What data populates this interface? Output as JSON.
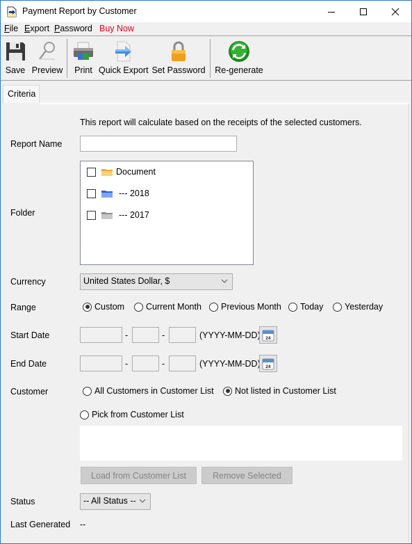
{
  "window": {
    "title": "Payment Report by Customer",
    "controls": {
      "minimize": "minimize",
      "maximize": "maximize",
      "close": "close"
    }
  },
  "menu": {
    "items": [
      {
        "label": "File",
        "accel": "F"
      },
      {
        "label": "Export",
        "accel": "E"
      },
      {
        "label": "Password",
        "accel": "P"
      },
      {
        "label": "Buy Now",
        "accel": "o"
      }
    ],
    "buy_now_color": "#e0001b"
  },
  "toolbar": {
    "buttons": [
      {
        "label": "Save",
        "icon": "floppy-disk-icon"
      },
      {
        "label": "Preview",
        "icon": "magnifier-icon"
      },
      {
        "label": "Print",
        "icon": "printer-icon"
      },
      {
        "label": "Quick Export",
        "icon": "export-arrow-icon"
      },
      {
        "label": "Set Password",
        "icon": "padlock-icon"
      },
      {
        "label": "Re-generate",
        "icon": "refresh-icon"
      }
    ]
  },
  "tabs": [
    {
      "label": "Criteria",
      "active": true
    }
  ],
  "form": {
    "intro": "This report will calculate based on the receipts of the selected customers.",
    "report_name": {
      "label": "Report Name",
      "value": ""
    },
    "folder": {
      "label": "Folder",
      "items": [
        {
          "label": "Document",
          "checked": false,
          "icon": "folder-yellow-icon"
        },
        {
          "label": "--- 2018",
          "checked": false,
          "icon": "folder-blue-icon"
        },
        {
          "label": "--- 2017",
          "checked": false,
          "icon": "folder-gray-icon"
        }
      ]
    },
    "currency": {
      "label": "Currency",
      "value": "United States Dollar, $"
    },
    "range": {
      "label": "Range",
      "options": [
        "Custom",
        "Current Month",
        "Previous Month",
        "Today",
        "Yesterday"
      ],
      "selected": "Custom"
    },
    "start_date": {
      "label": "Start Date",
      "year": "",
      "month": "",
      "day": "",
      "separator": "-",
      "format": "(YYYY-MM-DD)",
      "calendar_day": "24"
    },
    "end_date": {
      "label": "End Date",
      "year": "",
      "month": "",
      "day": "",
      "separator": "-",
      "format": "(YYYY-MM-DD)",
      "calendar_day": "24"
    },
    "customer": {
      "label": "Customer",
      "options": [
        "All Customers in Customer List",
        "Not listed in Customer List",
        "Pick from Customer List"
      ],
      "selected": "Not listed in Customer List",
      "list_items": [],
      "load_button": "Load from Customer List",
      "remove_button": "Remove Selected"
    },
    "status": {
      "label": "Status",
      "value": "-- All Status --"
    },
    "last_generated": {
      "label": "Last Generated",
      "value": "--"
    }
  }
}
